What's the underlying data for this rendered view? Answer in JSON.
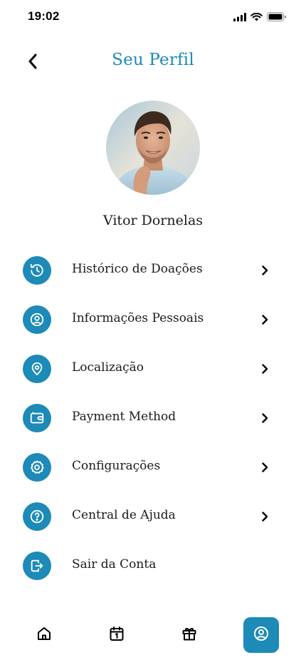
{
  "status_bar": {
    "time": "19:02",
    "icons": [
      "signal-icon",
      "wifi-icon",
      "battery-icon"
    ]
  },
  "header": {
    "title": "Seu Perfil",
    "back_icon": "chevron-left-icon"
  },
  "profile": {
    "name": "Vitor Dornelas",
    "avatar": "avatar-photo"
  },
  "menu": {
    "items": [
      {
        "label": "Histórico de Doações",
        "icon": "history-icon",
        "has_chevron": true
      },
      {
        "label": "Informações Pessoais",
        "icon": "user-circle-icon",
        "has_chevron": true
      },
      {
        "label": "Localização",
        "icon": "location-pin-icon",
        "has_chevron": true
      },
      {
        "label": "Payment Method",
        "icon": "wallet-icon",
        "has_chevron": true
      },
      {
        "label": "Configurações",
        "icon": "settings-gear-icon",
        "has_chevron": true
      },
      {
        "label": "Central de Ajuda",
        "icon": "help-circle-icon",
        "has_chevron": true
      },
      {
        "label": "Sair da Conta",
        "icon": "logout-icon",
        "has_chevron": false
      }
    ]
  },
  "bottom_nav": {
    "items": [
      {
        "icon": "home-icon",
        "active": false
      },
      {
        "icon": "calendar-icon",
        "active": false
      },
      {
        "icon": "gift-icon",
        "active": false
      },
      {
        "icon": "profile-icon",
        "active": true
      }
    ]
  },
  "colors": {
    "accent": "#1d8ab7",
    "text": "#1a1a1a",
    "background": "#ffffff"
  }
}
